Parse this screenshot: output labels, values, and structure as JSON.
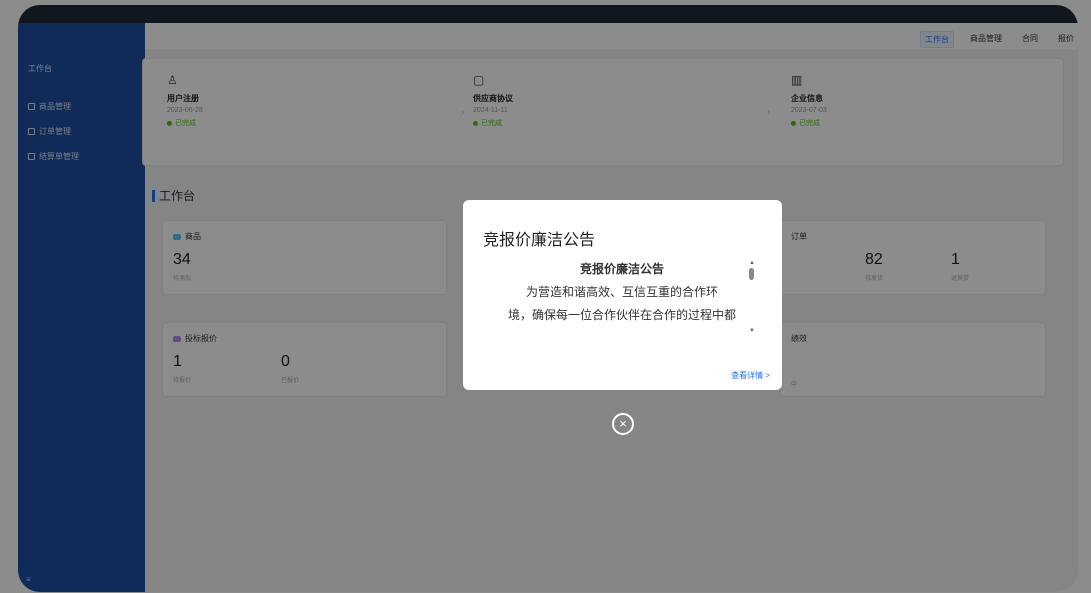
{
  "header": {
    "nav": [
      "工作台",
      "商品管理",
      "合同",
      "报价"
    ]
  },
  "sidebar": {
    "title": "工作台",
    "items": [
      {
        "label": "商品管理",
        "icon": "box-icon"
      },
      {
        "label": "订单管理",
        "icon": "order-icon"
      },
      {
        "label": "结算单管理",
        "icon": "ledger-icon"
      }
    ],
    "footer": "≡"
  },
  "flow": [
    {
      "icon": "user-add-icon",
      "glyph": "♙",
      "name": "用户注册",
      "date": "2023-06-28",
      "status": "已完成"
    },
    {
      "icon": "doc-icon",
      "glyph": "▢",
      "name": "供应商协议",
      "date": "2024-11-11",
      "status": "已完成"
    },
    {
      "icon": "building-icon",
      "glyph": "▥",
      "name": "企业信息",
      "date": "2023-07-03",
      "status": "已完成"
    }
  ],
  "workbench": {
    "title": "工作台",
    "goods": {
      "label": "商品",
      "value": "34",
      "sub": "待添加"
    },
    "orders": {
      "label": "订单",
      "values": [
        {
          "value": "82",
          "sub": "待发货"
        },
        {
          "value": "1",
          "sub": "退换货"
        }
      ]
    },
    "bids": {
      "label": "投标报价",
      "values": [
        {
          "value": "1",
          "sub": "待报价"
        },
        {
          "value": "0",
          "sub": "已报价"
        }
      ]
    },
    "performance": {
      "label": "绩效",
      "sub": "中"
    }
  },
  "modal": {
    "title": "竞报价廉洁公告",
    "notice_title": "竞报价廉洁公告",
    "notice_line1": "为营造和谐高效、互信互重的合作环",
    "notice_line2": "境，确保每一位合作伙伴在合作的过程中都",
    "detail_link": "查看详情 >",
    "close_symbol": "×"
  }
}
